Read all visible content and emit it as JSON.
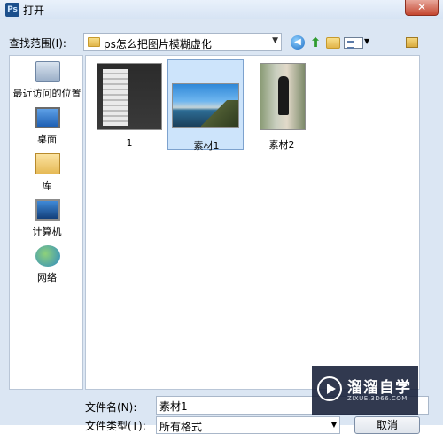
{
  "window": {
    "app_icon": "Ps",
    "title": "打开",
    "close": "✕"
  },
  "toolbar": {
    "lookin_label": "查找范围(I):",
    "lookin_value": "ps怎么把图片模糊虚化",
    "icons": [
      "back-icon",
      "up-folder-icon",
      "new-folder-icon",
      "views-menu-icon",
      "preview-icon"
    ]
  },
  "places": [
    {
      "label": "最近访问的位置",
      "icon": "recent-places-icon"
    },
    {
      "label": "桌面",
      "icon": "desktop-icon"
    },
    {
      "label": "库",
      "icon": "libraries-icon"
    },
    {
      "label": "计算机",
      "icon": "computer-icon"
    },
    {
      "label": "网络",
      "icon": "network-icon"
    }
  ],
  "files": [
    {
      "name": "1",
      "selected": false
    },
    {
      "name": "素材1",
      "selected": true
    },
    {
      "name": "素材2",
      "selected": false
    }
  ],
  "bottom": {
    "filename_label": "文件名(N):",
    "filename_value": "素材1",
    "filetype_label": "文件类型(T):",
    "filetype_value": "所有格式",
    "cancel_label": "取消"
  },
  "watermark": {
    "text": "溜溜自学",
    "url": "ZIXUE.3D66.COM"
  }
}
